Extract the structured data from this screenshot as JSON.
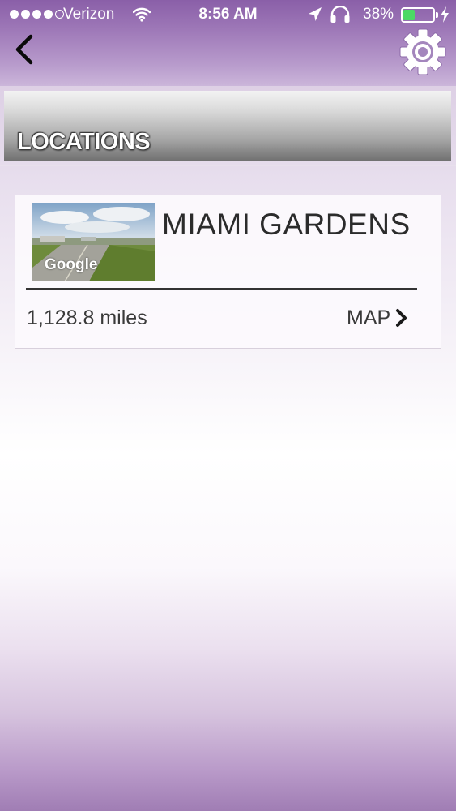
{
  "status_bar": {
    "carrier": "Verizon",
    "time": "8:56 AM",
    "battery_percent": "38%",
    "battery_level": 0.38,
    "signal_bars_filled": 4,
    "signal_bars_total": 5,
    "icons": [
      "wifi-icon",
      "location-arrow-icon",
      "headphones-icon",
      "battery-icon",
      "charging-bolt-icon"
    ]
  },
  "nav": {
    "back_icon": "chevron-left-icon",
    "settings_icon": "gear-icon"
  },
  "section": {
    "title": "LOCATIONS"
  },
  "locations": [
    {
      "name": "MIAMI GARDENS",
      "distance": "1,128.8 miles",
      "map_label": "MAP",
      "thumbnail_watermark": "Google"
    }
  ],
  "colors": {
    "header_purple": "#8a5fa8",
    "battery_green": "#4cd964",
    "text_dark": "#2b2b2b"
  }
}
